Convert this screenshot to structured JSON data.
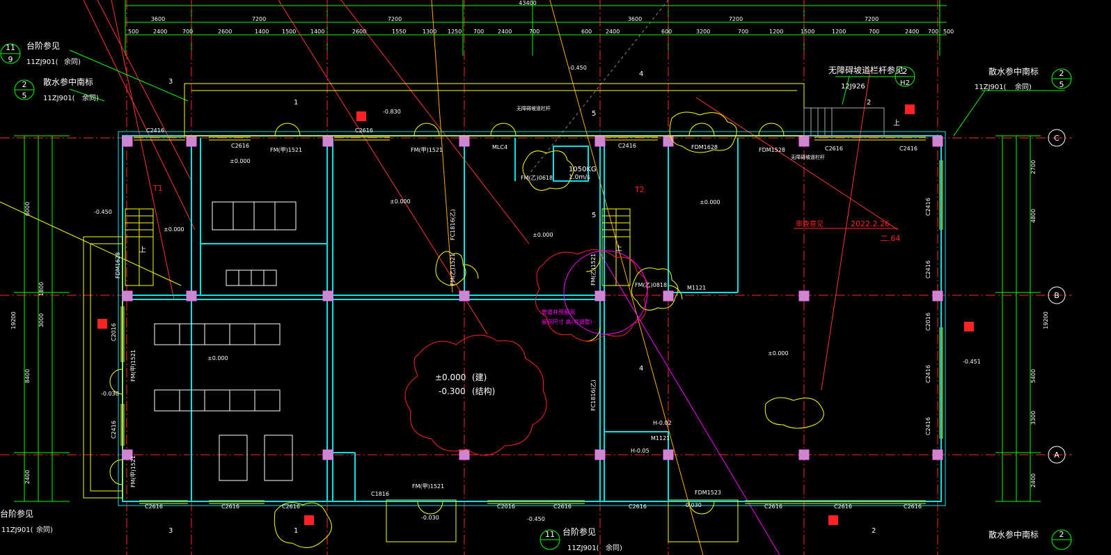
{
  "colors": {
    "background": "#000000",
    "wall": "#00e5e5",
    "column": "#ff66ff",
    "axis": "#ff2a2a",
    "dim": "#00ff00",
    "text": "#ffffff",
    "door": "#ffff00",
    "annotation": "#ff2222",
    "magenta": "#ff00ff"
  },
  "top_dims": {
    "overall": "43400",
    "spans": [
      "3600",
      "7200",
      "7200",
      "3600",
      "7200",
      "7200"
    ],
    "segments": [
      "500",
      "2400",
      "700",
      "2600",
      "1400",
      "1500",
      "1400",
      "2600",
      "1550",
      "1300",
      "1250",
      "700",
      "2400",
      "700",
      "600",
      "2400",
      "600",
      "3200",
      "700",
      "1200",
      "1500",
      "1200",
      "700",
      "2400",
      "700",
      "500"
    ]
  },
  "right_dims": {
    "overall": "19200",
    "spans": [
      "2700",
      "4800",
      "5400",
      "3300",
      "2400"
    ]
  },
  "left_dims": {
    "overall": "19200",
    "spans": [
      "6000",
      "3000",
      "1800",
      "8400",
      "2400"
    ]
  },
  "callouts": {
    "steps_ref_top": {
      "num": "11",
      "sheet": "9",
      "label": "台阶参见",
      "code": "11ZJ901(",
      "extra": "余同)"
    },
    "apron_ref_top": {
      "num": "2",
      "sheet": "5",
      "label": "散水参中南标",
      "code": "11ZJ901(",
      "extra": "余同)"
    },
    "apron_ref_right": {
      "num": "2",
      "sheet": "5",
      "label": "散水参中南标",
      "code": "11ZJ901(",
      "extra": "余同)"
    },
    "ramp_ref": {
      "num": "2",
      "sheet": "H2",
      "label": "无障碍坡道栏杆参见",
      "code": "12J926"
    },
    "steps_ref_bottom_left": {
      "label": "台阶参见",
      "code": "11ZJ901(",
      "extra": "余同)"
    },
    "steps_ref_bottom_mid": {
      "num": "11",
      "label": "台阶参见",
      "code": "11ZJ901(",
      "extra": "余同)"
    },
    "apron_ref_bottom": {
      "label": "散水参中南标",
      "num": "2"
    }
  },
  "axes_right": [
    "C",
    "B",
    "A"
  ],
  "door_labels": {
    "top": [
      "C2416",
      "C2616",
      "FM(甲)1521",
      "C2616",
      "FM(甲)1521",
      "MLC4",
      "C2416",
      "FDM1628",
      "FDM1528",
      "C2616",
      "C2416"
    ],
    "bottom": [
      "C2616",
      "C2616",
      "C2616",
      "C1816",
      "FM(甲)1521",
      "C2016",
      "C2616",
      "C2616",
      "FDM1523",
      "C2616",
      "C2616",
      "C2616"
    ],
    "left": [
      "FDM1628",
      "C2016",
      "FM(甲)1521",
      "C2416",
      "FM(甲)1521"
    ],
    "right": [
      "C2416",
      "C2416",
      "C2016",
      "C2416",
      "C2416"
    ],
    "interior": [
      "FM(乙)1521",
      "FM(乙)1521",
      "FC1816(乙)",
      "FC1816(乙)",
      "M1121",
      "M1121",
      "FM(乙)0618",
      "FM(乙)0818"
    ]
  },
  "levels": [
    "±0.000",
    "±0.000",
    "±0.000",
    "±0.000",
    "±0.000",
    "±0.000",
    "-0.450",
    "-0.450",
    "-0.451",
    "-0.030",
    "-0.030",
    "-0.030",
    "-0.830",
    "H-0.02",
    "H-0.05"
  ],
  "center_note": {
    "level": "±0.000",
    "level_tag": "(建)",
    "struct": "-0.300",
    "struct_tag": "(结构)"
  },
  "elevator": {
    "label": "1050KG",
    "speed": "1.0m/s"
  },
  "red_note": {
    "text": "审查意见",
    "date": "2022.2.26",
    "ref": "二.64"
  },
  "magenta_note": {
    "line1": "管道井预留洞",
    "line2": "留洞尺寸 高(可调整)"
  },
  "tags": {
    "t1": "T1",
    "t2": "T2",
    "up1": "上",
    "up2": "上",
    "up3": "上"
  },
  "sections": [
    "1",
    "2",
    "3",
    "4",
    "5",
    "4",
    "5",
    "1",
    "3",
    "2"
  ],
  "ramp_note": "无障碍坡道栏杆",
  "ramp_note2": "无障碍坡道栏杆"
}
